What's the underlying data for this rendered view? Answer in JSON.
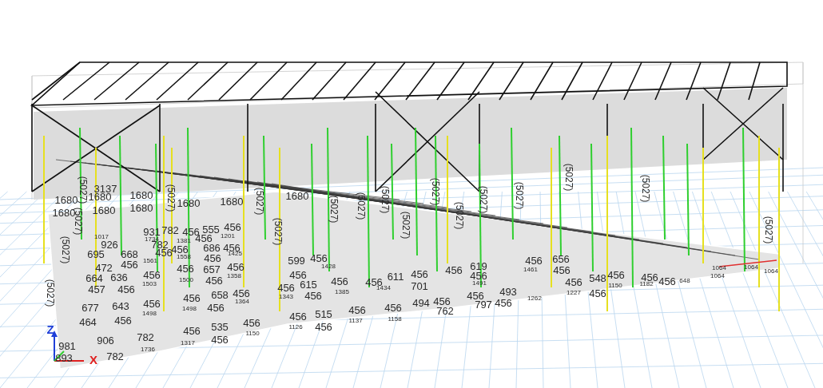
{
  "viewport": {
    "labels": [
      {
        "text": "1680",
        "kind": "value"
      },
      {
        "text": "1680",
        "kind": "value"
      },
      {
        "text": "1680",
        "kind": "value"
      },
      {
        "text": "1680",
        "kind": "value"
      },
      {
        "text": "1680",
        "kind": "value"
      },
      {
        "text": "1680",
        "kind": "value"
      },
      {
        "text": "1680",
        "kind": "value"
      },
      {
        "text": "1680",
        "kind": "value"
      },
      {
        "text": "1680",
        "kind": "value"
      },
      {
        "text": "3137",
        "kind": "value"
      },
      {
        "text": "(5027)",
        "kind": "axial"
      },
      {
        "text": "(5027)",
        "kind": "axial"
      },
      {
        "text": "(5027)",
        "kind": "axial"
      },
      {
        "text": "(5027)",
        "kind": "axial"
      },
      {
        "text": "(5027)",
        "kind": "axial"
      },
      {
        "text": "(5027)",
        "kind": "axial"
      },
      {
        "text": "(5027)",
        "kind": "axial"
      },
      {
        "text": "(5027)",
        "kind": "axial"
      },
      {
        "text": "(5027)",
        "kind": "axial"
      },
      {
        "text": "(5027)",
        "kind": "axial"
      },
      {
        "text": "(5027)",
        "kind": "axial"
      },
      {
        "text": "(5027)",
        "kind": "axial"
      },
      {
        "text": "(5027)",
        "kind": "axial"
      },
      {
        "text": "(5027)",
        "kind": "axial"
      },
      {
        "text": "(5027)",
        "kind": "axial"
      },
      {
        "text": "(5027)",
        "kind": "axial"
      },
      {
        "text": "(5027)",
        "kind": "axial"
      },
      {
        "text": "(5027)",
        "kind": "axial"
      },
      {
        "text": "1017",
        "kind": "note"
      },
      {
        "text": "931",
        "kind": "value"
      },
      {
        "text": "782",
        "kind": "value"
      },
      {
        "text": "926",
        "kind": "value"
      },
      {
        "text": "782",
        "kind": "value"
      },
      {
        "text": "1734",
        "kind": "note"
      },
      {
        "text": "695",
        "kind": "value"
      },
      {
        "text": "668",
        "kind": "value"
      },
      {
        "text": "456",
        "kind": "value"
      },
      {
        "text": "472",
        "kind": "value"
      },
      {
        "text": "456",
        "kind": "value"
      },
      {
        "text": "1561",
        "kind": "note"
      },
      {
        "text": "664",
        "kind": "value"
      },
      {
        "text": "636",
        "kind": "value"
      },
      {
        "text": "456",
        "kind": "value"
      },
      {
        "text": "457",
        "kind": "value"
      },
      {
        "text": "456",
        "kind": "value"
      },
      {
        "text": "1503",
        "kind": "note"
      },
      {
        "text": "677",
        "kind": "value"
      },
      {
        "text": "643",
        "kind": "value"
      },
      {
        "text": "456",
        "kind": "value"
      },
      {
        "text": "464",
        "kind": "value"
      },
      {
        "text": "456",
        "kind": "value"
      },
      {
        "text": "1498",
        "kind": "note"
      },
      {
        "text": "981",
        "kind": "value"
      },
      {
        "text": "906",
        "kind": "value"
      },
      {
        "text": "782",
        "kind": "value"
      },
      {
        "text": "893",
        "kind": "value"
      },
      {
        "text": "782",
        "kind": "value"
      },
      {
        "text": "1736",
        "kind": "note"
      },
      {
        "text": "456",
        "kind": "value"
      },
      {
        "text": "555",
        "kind": "value"
      },
      {
        "text": "456",
        "kind": "value"
      },
      {
        "text": "1381",
        "kind": "note"
      },
      {
        "text": "456",
        "kind": "value"
      },
      {
        "text": "1201",
        "kind": "note"
      },
      {
        "text": "456",
        "kind": "value"
      },
      {
        "text": "686",
        "kind": "value"
      },
      {
        "text": "456",
        "kind": "value"
      },
      {
        "text": "1558",
        "kind": "note"
      },
      {
        "text": "456",
        "kind": "value"
      },
      {
        "text": "1425",
        "kind": "note"
      },
      {
        "text": "456",
        "kind": "value"
      },
      {
        "text": "657",
        "kind": "value"
      },
      {
        "text": "456",
        "kind": "value"
      },
      {
        "text": "1500",
        "kind": "note"
      },
      {
        "text": "456",
        "kind": "value"
      },
      {
        "text": "1358",
        "kind": "note"
      },
      {
        "text": "456",
        "kind": "value"
      },
      {
        "text": "658",
        "kind": "value"
      },
      {
        "text": "456",
        "kind": "value"
      },
      {
        "text": "1498",
        "kind": "note"
      },
      {
        "text": "456",
        "kind": "value"
      },
      {
        "text": "1364",
        "kind": "note"
      },
      {
        "text": "456",
        "kind": "value"
      },
      {
        "text": "535",
        "kind": "value"
      },
      {
        "text": "456",
        "kind": "value"
      },
      {
        "text": "1317",
        "kind": "note"
      },
      {
        "text": "456",
        "kind": "value"
      },
      {
        "text": "1150",
        "kind": "note"
      },
      {
        "text": "599",
        "kind": "value"
      },
      {
        "text": "456",
        "kind": "value"
      },
      {
        "text": "1428",
        "kind": "note"
      },
      {
        "text": "456",
        "kind": "value"
      },
      {
        "text": "456",
        "kind": "value"
      },
      {
        "text": "615",
        "kind": "value"
      },
      {
        "text": "456",
        "kind": "value"
      },
      {
        "text": "1343",
        "kind": "note"
      },
      {
        "text": "456",
        "kind": "value"
      },
      {
        "text": "1385",
        "kind": "note"
      },
      {
        "text": "456",
        "kind": "value"
      },
      {
        "text": "515",
        "kind": "value"
      },
      {
        "text": "456",
        "kind": "value"
      },
      {
        "text": "1126",
        "kind": "note"
      },
      {
        "text": "456",
        "kind": "value"
      },
      {
        "text": "1137",
        "kind": "note"
      },
      {
        "text": "456",
        "kind": "value"
      },
      {
        "text": "611",
        "kind": "value"
      },
      {
        "text": "1434",
        "kind": "note"
      },
      {
        "text": "456",
        "kind": "value"
      },
      {
        "text": "701",
        "kind": "value"
      },
      {
        "text": "456",
        "kind": "value"
      },
      {
        "text": "494",
        "kind": "value"
      },
      {
        "text": "1158",
        "kind": "note"
      },
      {
        "text": "456",
        "kind": "value"
      },
      {
        "text": "762",
        "kind": "value"
      },
      {
        "text": "456",
        "kind": "value"
      },
      {
        "text": "619",
        "kind": "value"
      },
      {
        "text": "456",
        "kind": "value"
      },
      {
        "text": "1491",
        "kind": "note"
      },
      {
        "text": "456",
        "kind": "value"
      },
      {
        "text": "493",
        "kind": "value"
      },
      {
        "text": "797",
        "kind": "value"
      },
      {
        "text": "456",
        "kind": "value"
      },
      {
        "text": "456",
        "kind": "value"
      },
      {
        "text": "656",
        "kind": "value"
      },
      {
        "text": "1461",
        "kind": "note"
      },
      {
        "text": "456",
        "kind": "value"
      },
      {
        "text": "1262",
        "kind": "note"
      },
      {
        "text": "456",
        "kind": "value"
      },
      {
        "text": "548",
        "kind": "value"
      },
      {
        "text": "456",
        "kind": "value"
      },
      {
        "text": "1227",
        "kind": "note"
      },
      {
        "text": "456",
        "kind": "value"
      },
      {
        "text": "1150",
        "kind": "note"
      },
      {
        "text": "456",
        "kind": "value"
      },
      {
        "text": "1182",
        "kind": "note"
      },
      {
        "text": "456",
        "kind": "value"
      },
      {
        "text": "648",
        "kind": "note"
      },
      {
        "text": "1064",
        "kind": "note"
      },
      {
        "text": "1064",
        "kind": "note"
      },
      {
        "text": "1064",
        "kind": "note"
      },
      {
        "text": "1064",
        "kind": "note"
      }
    ],
    "axes": [
      {
        "text": "Z",
        "color": "#1f3fd8"
      },
      {
        "text": "X",
        "color": "#e02020"
      }
    ]
  }
}
